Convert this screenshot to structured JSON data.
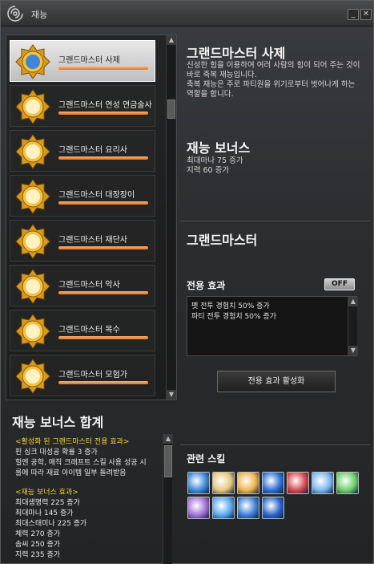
{
  "window": {
    "title": "재능"
  },
  "colors": {
    "accent_orange": "#e8782a",
    "highlight_yellow": "#f4d43a",
    "panel_dark": "#141414"
  },
  "job_list": [
    {
      "label": "그랜드마스터 사제",
      "selected": true,
      "icon": "bird-icon"
    },
    {
      "label": "그랜드마스터 연성 연금술사",
      "selected": false,
      "icon": "alchemy-icon"
    },
    {
      "label": "그랜드마스터 요리사",
      "selected": false,
      "icon": "chef-hat-icon"
    },
    {
      "label": "그랜드마스터 대장장이",
      "selected": false,
      "icon": "anvil-icon"
    },
    {
      "label": "그랜드마스터 재단사",
      "selected": false,
      "icon": "shirt-icon"
    },
    {
      "label": "그랜드마스터 악사",
      "selected": false,
      "icon": "lute-icon"
    },
    {
      "label": "그랜드마스터 목수",
      "selected": false,
      "icon": "saw-icon"
    },
    {
      "label": "그랜드마스터 모험가",
      "selected": false,
      "icon": "compass-icon"
    }
  ],
  "detail": {
    "title": "그랜드마스터 사제",
    "description": [
      "신성한 힘을 이용하여 여러 사람의 힘이 되어 주는 것이",
      "바로 축복 재능입니다.",
      "축복 재능은 주로 파티원을 위기로부터 벗어나게 하는",
      "역할을 합니다."
    ],
    "bonus_title": "재능 보너스",
    "bonus_lines": [
      "최대마나 75 증가",
      "지력 60 증가"
    ],
    "rank_title": "그랜드마스터",
    "effect_title": "전용 효과",
    "toggle_label": "OFF",
    "effect_lines": [
      "펫 전투 경험치 50% 증가",
      "파티 전투 경험치 50% 증가"
    ],
    "activate_button": "전용 효과 활성화",
    "skills_title": "관련 스킬",
    "skills": [
      "blue-orb-skill-icon",
      "hand-light-skill-icon",
      "scroll-skill-icon",
      "shield-skill-icon",
      "winged-heart-skill-icon",
      "spear-skill-icon",
      "green-spear-skill-icon",
      "purple-spear-skill-icon",
      "blue-spear-skill-icon",
      "wing-shield-skill-icon",
      "star-skill-icon"
    ]
  },
  "bonus_summary": {
    "title": "재능 보너스 합계",
    "active_header": "<활성화 된 그랜드마스터 전용 효과>",
    "active_lines": [
      "핀 싱크 대성공 확률 3 증가",
      "힐엔 공학, 매직 크래프트 스킬 사용 성공 시",
      "룰에 따라 재료 아이템 일부 돌려받음"
    ],
    "bonus_header": "<재능 보너스 효과>",
    "bonus_lines": [
      "최대생명력 225 증가",
      "최대마나 145 증가",
      "최대스태미나 225 증가",
      "체력 270 증가",
      "솜씨 250 증가",
      "지력 235 증가"
    ]
  }
}
